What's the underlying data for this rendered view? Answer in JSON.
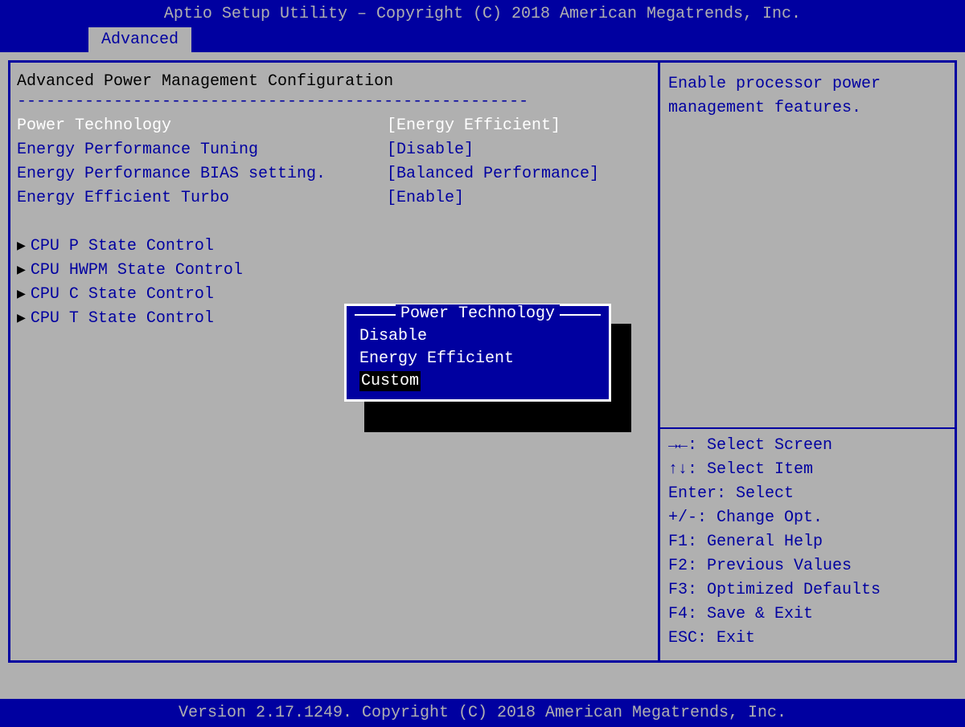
{
  "header": {
    "title": "Aptio Setup Utility – Copyright (C) 2018 American Megatrends, Inc."
  },
  "tabs": {
    "active": "Advanced"
  },
  "section_title": "Advanced Power Management Configuration",
  "divider": "-----------------------------------------------------",
  "settings": [
    {
      "label": "Power Technology",
      "value": "[Energy Efficient]",
      "selected": true
    },
    {
      "label": "Energy Performance Tuning",
      "value": "[Disable]",
      "selected": false
    },
    {
      "label": "Energy Performance BIAS setting.",
      "value": "[Balanced Performance]",
      "selected": false
    },
    {
      "label": "Energy Efficient Turbo",
      "value": "[Enable]",
      "selected": false
    }
  ],
  "submenus": [
    "CPU P State Control",
    "CPU HWPM State Control",
    "CPU C State Control",
    "CPU T State Control"
  ],
  "popup": {
    "title": "Power Technology",
    "options": [
      "Disable",
      "Energy Efficient",
      "Custom"
    ],
    "highlighted_index": 2
  },
  "help_text": "Enable processor power management features.",
  "shortcuts": [
    {
      "key": "→←",
      "label": ": Select Screen"
    },
    {
      "key": "↑↓",
      "label": ": Select Item"
    },
    {
      "key": "Enter",
      "label": ": Select"
    },
    {
      "key": "+/-",
      "label": ": Change Opt."
    },
    {
      "key": "F1",
      "label": ": General Help"
    },
    {
      "key": "F2",
      "label": ": Previous Values"
    },
    {
      "key": "F3",
      "label": ": Optimized Defaults"
    },
    {
      "key": "F4",
      "label": ": Save & Exit"
    },
    {
      "key": "ESC",
      "label": ": Exit"
    }
  ],
  "footer": {
    "text": "Version 2.17.1249. Copyright (C) 2018 American Megatrends, Inc."
  }
}
